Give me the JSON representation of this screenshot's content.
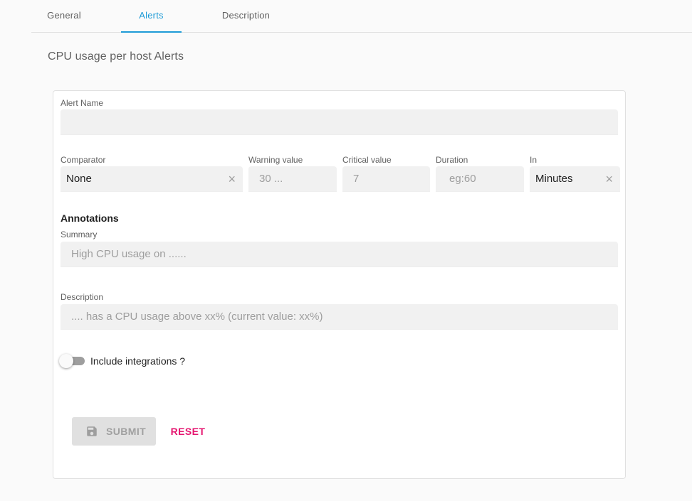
{
  "tabs": [
    {
      "label": "General",
      "active": false
    },
    {
      "label": "Alerts",
      "active": true
    },
    {
      "label": "Description",
      "active": false
    }
  ],
  "page_title": "CPU usage per host Alerts",
  "form": {
    "alert_name": {
      "label": "Alert Name",
      "value": ""
    },
    "comparator": {
      "label": "Comparator",
      "value": "None"
    },
    "warning": {
      "label": "Warning value",
      "placeholder": "30 ..."
    },
    "critical": {
      "label": "Critical value",
      "placeholder": "7"
    },
    "duration": {
      "label": "Duration",
      "placeholder": "eg:60"
    },
    "in": {
      "label": "In",
      "value": "Minutes"
    },
    "annotations_title": "Annotations",
    "summary": {
      "label": "Summary",
      "placeholder": "High CPU usage on ......"
    },
    "description": {
      "label": "Description",
      "placeholder": ".... has a CPU usage above xx% (current value: xx%)"
    },
    "integrations_label": "Include integrations ?",
    "integrations_enabled": false,
    "clear_glyph": "×"
  },
  "buttons": {
    "submit": "SUBMIT",
    "reset": "RESET"
  },
  "colors": {
    "accent": "#1e9bd7",
    "reset": "#e5156f"
  }
}
